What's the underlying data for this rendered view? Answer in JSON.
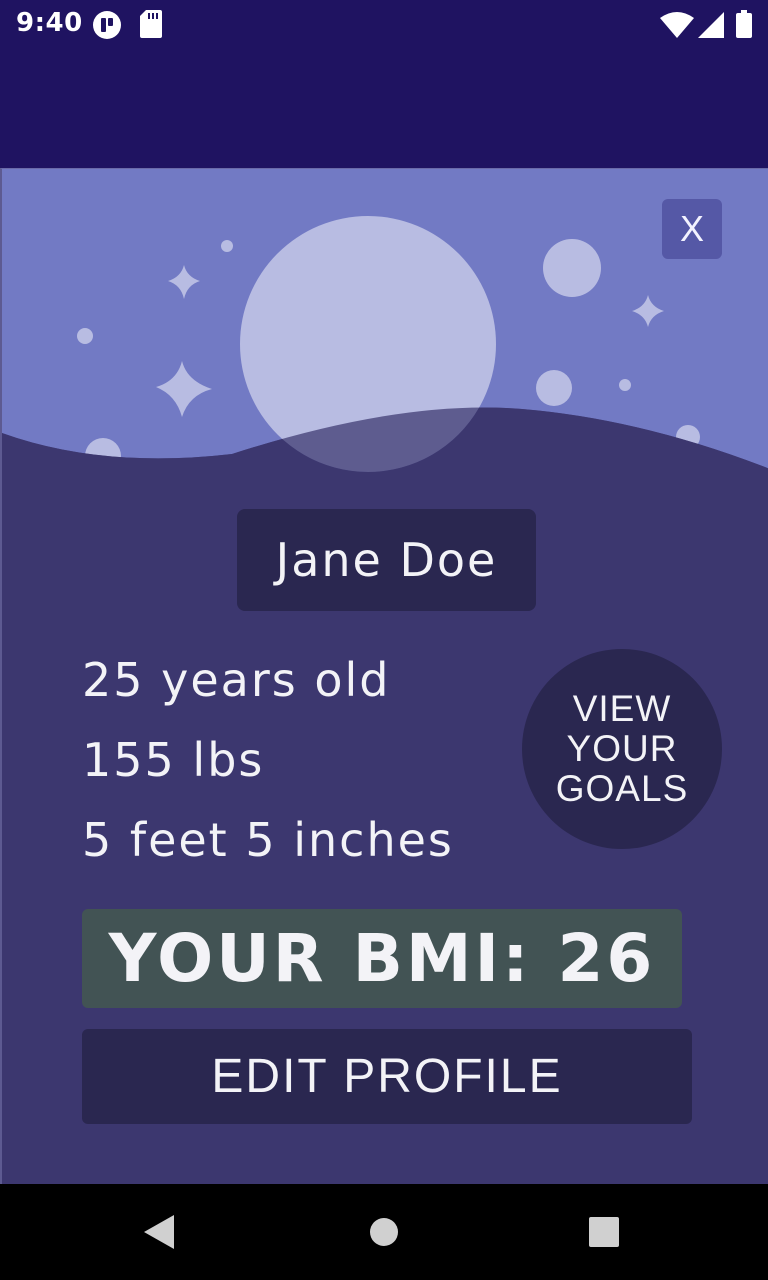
{
  "status_bar": {
    "time": "9:40",
    "icons": [
      "app-notification-icon",
      "sd-card-icon",
      "wifi-icon",
      "cell-signal-icon",
      "battery-icon"
    ]
  },
  "profile": {
    "close_label": "X",
    "name": "Jane Doe",
    "age": "25 years old",
    "weight": "155 lbs",
    "height": "5 feet 5 inches",
    "goals_button": [
      "VIEW",
      "YOUR",
      "GOALS"
    ],
    "bmi": "YOUR BMI: 26",
    "edit_label": "EDIT PROFILE"
  },
  "nav_bar": {
    "buttons": [
      "back-icon",
      "home-icon",
      "recents-icon"
    ]
  },
  "colors": {
    "app_bar": "#1f1361",
    "card": "#3c376f",
    "sky": "#727ac4",
    "dark_button": "#2a2750",
    "bmi": "#425354"
  }
}
